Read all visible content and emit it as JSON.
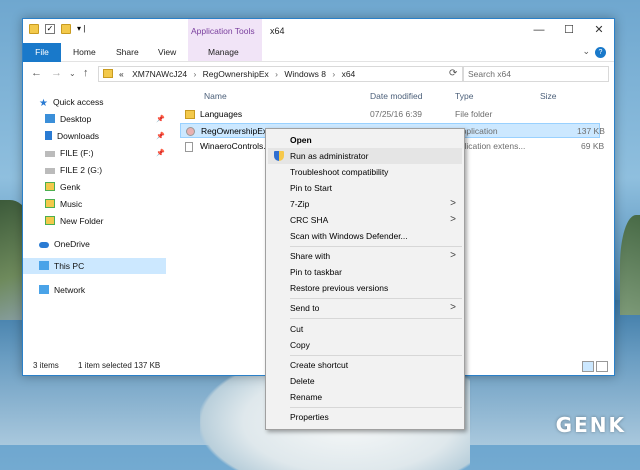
{
  "window": {
    "title": "x64",
    "tools_label": "Application Tools"
  },
  "ribbon": {
    "tabs": [
      "File",
      "Home",
      "Share",
      "View",
      "Manage"
    ],
    "help": "?"
  },
  "address": {
    "parts": [
      "«",
      "XM7NAWcJ24",
      "RegOwnershipEx",
      "Windows 8",
      "x64"
    ],
    "search_placeholder": "Search x64"
  },
  "nav": {
    "items": [
      {
        "label": "Quick access",
        "icon": "star-icon"
      },
      {
        "label": "Desktop",
        "icon": "desktop-icon"
      },
      {
        "label": "Downloads",
        "icon": "downloads-icon"
      },
      {
        "label": "FILE (F:)",
        "icon": "drive-icon"
      },
      {
        "label": "FILE 2 (G:)",
        "icon": "drive-icon"
      },
      {
        "label": "Genk",
        "icon": "folder-icon"
      },
      {
        "label": "Music",
        "icon": "folder-icon"
      },
      {
        "label": "New Folder",
        "icon": "folder-icon"
      },
      {
        "label": "OneDrive",
        "icon": "cloud-icon"
      },
      {
        "label": "This PC",
        "icon": "pc-icon"
      },
      {
        "label": "Network",
        "icon": "network-icon"
      }
    ]
  },
  "columns": {
    "name": "Name",
    "date": "Date modified",
    "type": "Type",
    "size": "Size"
  },
  "files": [
    {
      "name": "Languages",
      "date": "07/25/16 6:39",
      "type": "File folder",
      "size": ""
    },
    {
      "name": "RegOwnershipEx.e",
      "date": "",
      "type": "Application",
      "size": "137 KB"
    },
    {
      "name": "WinaeroControls.",
      "date": "",
      "type": "pplication extens...",
      "size": "69 KB"
    }
  ],
  "status": {
    "count": "3 items",
    "selected": "1 item selected  137 KB"
  },
  "menu": {
    "items": [
      {
        "label": "Open",
        "arrow": ""
      },
      {
        "label": "Run as administrator",
        "arrow": ""
      },
      {
        "label": "Troubleshoot compatibility",
        "arrow": ""
      },
      {
        "label": "Pin to Start",
        "arrow": ""
      },
      {
        "label": "7-Zip",
        "arrow": ">"
      },
      {
        "label": "CRC SHA",
        "arrow": ">"
      },
      {
        "label": "Scan with Windows Defender...",
        "arrow": ""
      },
      {
        "label": "Share with",
        "arrow": ">"
      },
      {
        "label": "Pin to taskbar",
        "arrow": ""
      },
      {
        "label": "Restore previous versions",
        "arrow": ""
      },
      {
        "label": "Send to",
        "arrow": ">"
      },
      {
        "label": "Cut",
        "arrow": ""
      },
      {
        "label": "Copy",
        "arrow": ""
      },
      {
        "label": "Create shortcut",
        "arrow": ""
      },
      {
        "label": "Delete",
        "arrow": ""
      },
      {
        "label": "Rename",
        "arrow": ""
      },
      {
        "label": "Properties",
        "arrow": ""
      }
    ]
  },
  "watermark": "GENK",
  "colors": {
    "accent": "#1979ca",
    "selection": "#cce8ff",
    "tools_tab": "#f1e4f7"
  }
}
